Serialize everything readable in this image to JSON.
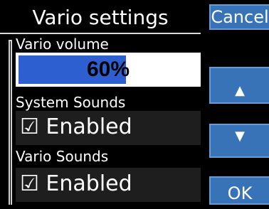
{
  "header": {
    "title": "Vario settings"
  },
  "buttons": {
    "cancel_label": "Cancel",
    "up_icon": "triangle-up-icon",
    "down_icon": "triangle-down-icon",
    "ok_label": "OK",
    "accent_color": "#3873b8"
  },
  "settings": {
    "vario_volume": {
      "label": "Vario volume",
      "value_text": "60%",
      "value": 60,
      "fill_color": "#2d5fd0"
    },
    "system_sounds": {
      "label": "System Sounds",
      "value_text": "☑ Enabled"
    },
    "vario_sounds": {
      "label": "Vario Sounds",
      "value_text": "☑ Enabled"
    }
  }
}
